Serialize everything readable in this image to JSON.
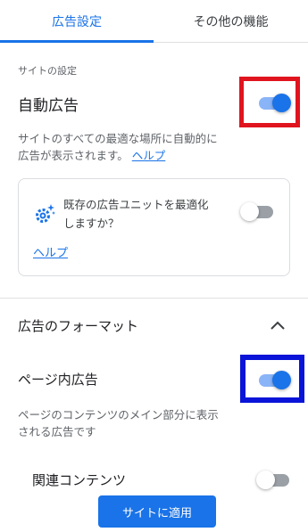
{
  "tabs": [
    {
      "label": "広告設定",
      "active": true
    },
    {
      "label": "その他の機能",
      "active": false
    }
  ],
  "site_settings": {
    "caption": "サイトの設定",
    "auto_ads": {
      "title": "自動広告",
      "enabled": true,
      "description_line1": "サイトのすべての最適な場所に自動的に",
      "description_line2": "広告が表示されます。",
      "help_link": "ヘルプ"
    },
    "optimize_card": {
      "icon": "gear-sparkle-icon",
      "text_line1": "既存の広告ユニットを最適化",
      "text_line2": "しますか？",
      "enabled": false,
      "help_link": "ヘルプ"
    }
  },
  "ad_formats": {
    "section_title": "広告のフォーマット",
    "expanded": true,
    "in_page": {
      "title": "ページ内広告",
      "enabled": true,
      "description_line1": "ページのコンテンツのメイン部分に表示",
      "description_line2": "される広告です"
    },
    "related_content": {
      "title": "関連コンテンツ",
      "enabled": false
    }
  },
  "apply_button": "サイトに適用",
  "colors": {
    "accent": "#1a73e8",
    "highlight_red": "#e0141f",
    "highlight_blue": "#0a14d8"
  }
}
